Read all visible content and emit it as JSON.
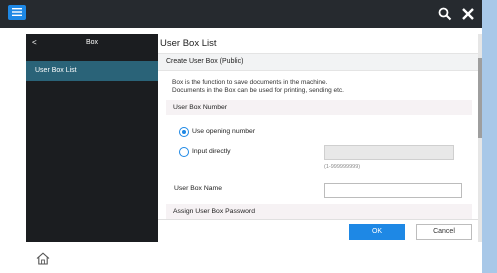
{
  "topbar": {
    "menu_icon": "menu-icon",
    "search_icon": "search-icon",
    "close_icon": "close-icon"
  },
  "sidebar": {
    "back": "<",
    "title": "Box",
    "items": [
      {
        "label": "User Box List",
        "selected": true
      }
    ]
  },
  "main": {
    "title": "User Box List",
    "subheader": "Create User Box (Public)",
    "description_line1": "Box is the function to save documents in the machine.",
    "description_line2": "Documents in the Box can be used for printing, sending etc.",
    "section_number": "User Box Number",
    "radio_opening": "Use opening number",
    "radio_direct": "Input directly",
    "direct_value": "",
    "range_hint": "(1-999999999)",
    "name_label": "User Box Name",
    "name_value": "",
    "section_password": "Assign User Box Password"
  },
  "footer": {
    "ok_label": "OK",
    "cancel_label": "Cancel"
  },
  "bottom": {
    "home_icon": "home-icon"
  },
  "colors": {
    "accent": "#1e88e5",
    "topbar": "#262a2f",
    "sidebar": "#1b1d20",
    "sidebar_selected": "#2a6378",
    "page_background": "#a8c8e8"
  }
}
